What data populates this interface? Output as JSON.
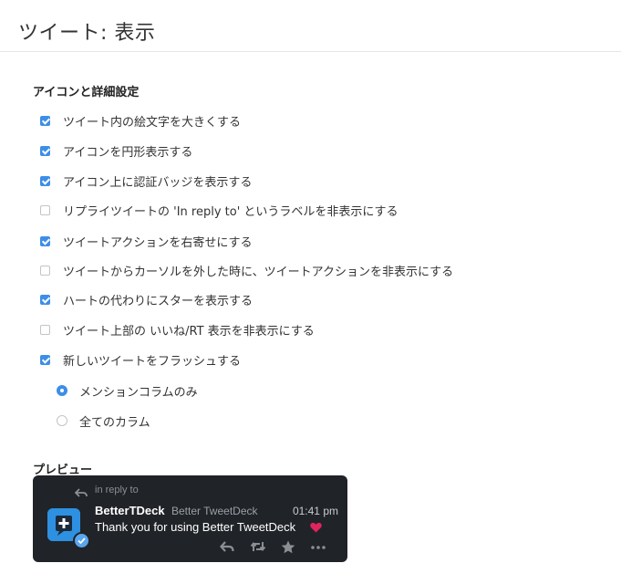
{
  "header": {
    "title": "ツイート: 表示"
  },
  "icon_section": {
    "title": "アイコンと詳細設定",
    "options": [
      {
        "label": "ツイート内の絵文字を大きくする",
        "checked": true
      },
      {
        "label": "アイコンを円形表示する",
        "checked": true
      },
      {
        "label": "アイコン上に認証バッジを表示する",
        "checked": true
      },
      {
        "label": "リプライツイートの 'In reply to' というラベルを非表示にする",
        "checked": false
      },
      {
        "label": "ツイートアクションを右寄せにする",
        "checked": true
      },
      {
        "label": "ツイートからカーソルを外した時に、ツイートアクションを非表示にする",
        "checked": false
      },
      {
        "label": "ハートの代わりにスターを表示する",
        "checked": true
      },
      {
        "label": "ツイート上部の いいね/RT 表示を非表示にする",
        "checked": false
      },
      {
        "label": "新しいツイートをフラッシュする",
        "checked": true
      }
    ],
    "flash_scope": [
      {
        "label": "メンションコラムのみ",
        "selected": true
      },
      {
        "label": "全てのカラム",
        "selected": false
      }
    ]
  },
  "preview_section": {
    "title": "プレビュー",
    "tweet": {
      "in_reply_to": "in reply to",
      "display_name": "BetterTDeck",
      "handle": "Better TweetDeck",
      "time": "01:41 pm",
      "text": "Thank you for using Better TweetDeck",
      "emoji": "heart-icon",
      "actions": [
        "reply-icon",
        "retweet-icon",
        "star-icon",
        "more-icon"
      ]
    }
  },
  "colors": {
    "accent": "#3d8ee8",
    "preview_bg": "#202327",
    "heart": "#e0245e"
  }
}
